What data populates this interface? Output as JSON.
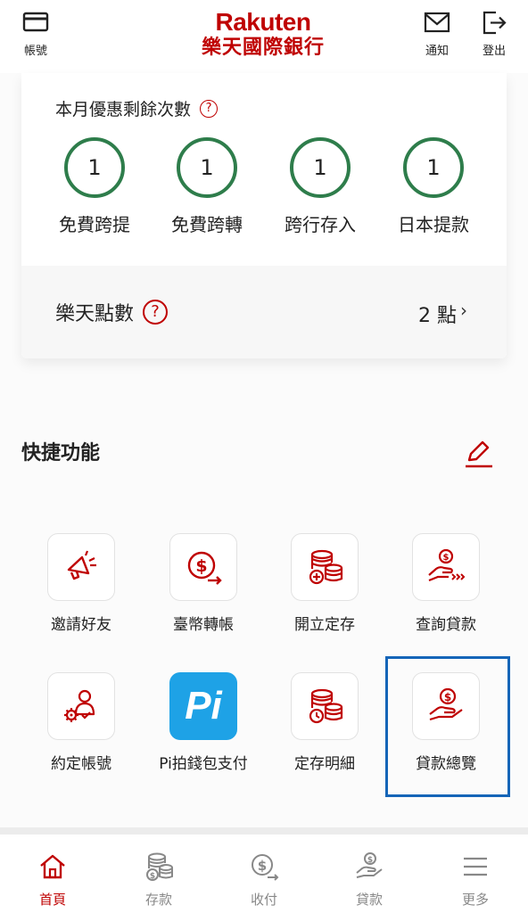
{
  "header": {
    "account_label": "帳號",
    "logo_en": "Rakuten",
    "logo_zh": "樂天國際銀行",
    "notify_label": "通知",
    "logout_label": "登出"
  },
  "benefits": {
    "title": "本月優惠剩餘次數",
    "help": "?",
    "items": [
      {
        "count": "1",
        "label": "免費跨提"
      },
      {
        "count": "1",
        "label": "免費跨轉"
      },
      {
        "count": "1",
        "label": "跨行存入"
      },
      {
        "count": "1",
        "label": "日本提款"
      }
    ]
  },
  "points": {
    "label": "樂天點數",
    "help": "?",
    "value": "2 點",
    "arrow": "›"
  },
  "quick": {
    "title": "快捷功能",
    "items": [
      {
        "label": "邀請好友",
        "icon": "megaphone-icon"
      },
      {
        "label": "臺幣轉帳",
        "icon": "dollar-transfer-icon"
      },
      {
        "label": "開立定存",
        "icon": "coins-add-icon"
      },
      {
        "label": "查詢貸款",
        "icon": "loan-search-icon"
      },
      {
        "label": "約定帳號",
        "icon": "user-gear-icon"
      },
      {
        "label": "Pi拍錢包支付",
        "icon": "pi-wallet-icon",
        "icon_text": "Pi"
      },
      {
        "label": "定存明細",
        "icon": "coins-clock-icon"
      },
      {
        "label": "貸款總覽",
        "icon": "hand-coin-icon"
      }
    ]
  },
  "nav": {
    "items": [
      {
        "label": "首頁",
        "icon": "home-icon",
        "active": true
      },
      {
        "label": "存款",
        "icon": "coins-icon",
        "active": false
      },
      {
        "label": "收付",
        "icon": "dollar-arrow-icon",
        "active": false
      },
      {
        "label": "貸款",
        "icon": "hand-coin-icon",
        "active": false
      },
      {
        "label": "更多",
        "icon": "menu-icon",
        "active": false
      }
    ]
  },
  "colors": {
    "brand": "#bf0000",
    "ring": "#2e7d4b",
    "pi": "#1ea2e6",
    "highlight": "#1565b8"
  }
}
